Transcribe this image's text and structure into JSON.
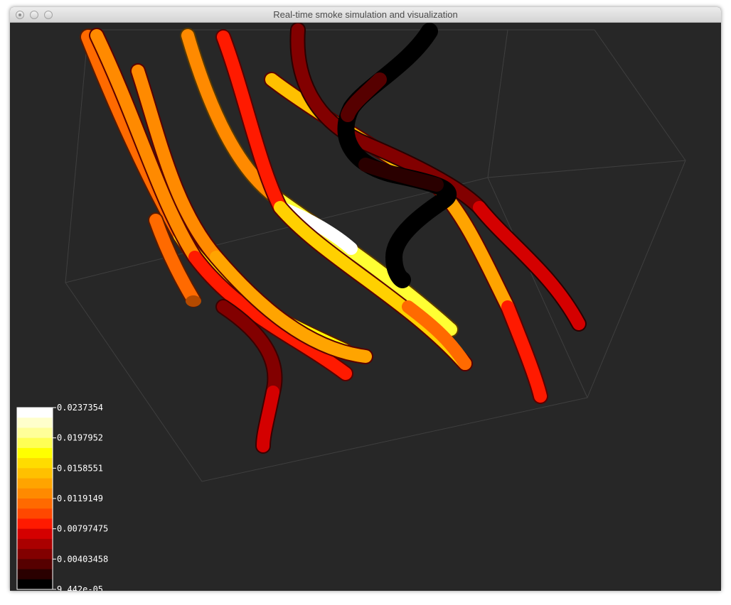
{
  "window": {
    "title": "Real-time smoke simulation and visualization"
  },
  "legend": {
    "labels": [
      "0.0237354",
      "0.0197952",
      "0.0158551",
      "0.0119149",
      "0.00797475",
      "0.00403458",
      "9.442e-05"
    ],
    "colors": [
      "#000000",
      "#2a0000",
      "#560000",
      "#820000",
      "#aa0000",
      "#d40000",
      "#ff1a00",
      "#ff4800",
      "#ff6a00",
      "#ff8a00",
      "#ffa400",
      "#ffc000",
      "#ffdc00",
      "#ffff00",
      "#ffff55",
      "#ffff99",
      "#ffffcc",
      "#ffffff"
    ]
  }
}
